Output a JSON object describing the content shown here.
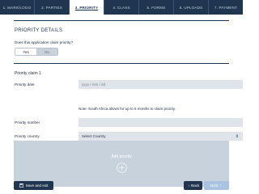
{
  "tabs": [
    {
      "label": "1. MARK/LOGO"
    },
    {
      "label": "2. PARTIES"
    },
    {
      "label": "3. PRIORITY"
    },
    {
      "label": "4. CLASS"
    },
    {
      "label": "5. FORMS"
    },
    {
      "label": "6. UPLOADS"
    },
    {
      "label": "7. PAYMENT"
    }
  ],
  "active_tab_index": 2,
  "section_title": "PRIORITY DETAILS",
  "claim_question": "Does this application claim priority?",
  "toggle": {
    "yes_label": "Yes",
    "no_label": "No",
    "selected": "Yes"
  },
  "claim": {
    "heading": "Priority claim 1",
    "date_label": "Priority date",
    "date_placeholder": "yyyy / mm / dd",
    "note": "Note: South Africa allows for up to 6 months to claim priority.",
    "number_label": "Priority number",
    "number_value": "",
    "country_label": "Priority country",
    "country_value": "Select Country"
  },
  "add_priority_label": "Add priority",
  "footer": {
    "save_label": "Save and exit",
    "back_label": "Back",
    "next_label": "Next"
  },
  "colors": {
    "navy": "#1f3550",
    "field_bg": "#dfe4ea",
    "panel_bg": "#c8d2dd",
    "next_disabled": "#a9c3e0"
  }
}
